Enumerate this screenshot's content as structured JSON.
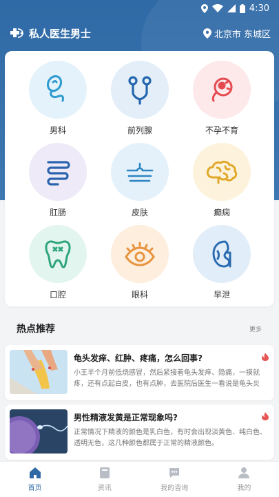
{
  "status": {
    "time": "4:30"
  },
  "header": {
    "title": "私人医生男士",
    "location": "北京市 东城区"
  },
  "categories": [
    {
      "label": "男科",
      "icon": "sperm-icon",
      "bg": "#e3f2fb"
    },
    {
      "label": "前列腺",
      "icon": "prostate-icon",
      "bg": "#e3eef9"
    },
    {
      "label": "不孕不育",
      "icon": "infertility-icon",
      "bg": "#fde8ea"
    },
    {
      "label": "肛肠",
      "icon": "intestine-icon",
      "bg": "#eeeaf7"
    },
    {
      "label": "皮肤",
      "icon": "skin-icon",
      "bg": "#e4f1fb"
    },
    {
      "label": "癫痫",
      "icon": "brain-icon",
      "bg": "#fdf3dc"
    },
    {
      "label": "口腔",
      "icon": "tooth-icon",
      "bg": "#e2f5ee"
    },
    {
      "label": "眼科",
      "icon": "eye-icon",
      "bg": "#fdeede"
    },
    {
      "label": "早泄",
      "icon": "kidney-icon",
      "bg": "#e1eef9"
    }
  ],
  "hot": {
    "title": "热点推荐",
    "more": "更多",
    "items": [
      {
        "title": "龟头发痒、红肿、疼痛，怎么回事?",
        "desc": "小王半个月前低烧感冒，然后紧接着龟头发痒、隐痛，一摸就疼，还有点起白皮，也有点肿，去医院后医生一看说是龟头炎"
      },
      {
        "title": "男性精液发黄是正常现象吗?",
        "desc": "正常情况下精液的颜色是乳白色，有时会出现淡黄色、纯白色、透明无色，这几种颜色都属于正常的精液颜色。"
      }
    ]
  },
  "tabs": [
    {
      "label": "首页",
      "icon": "home-icon"
    },
    {
      "label": "资讯",
      "icon": "news-icon"
    },
    {
      "label": "我的咨询",
      "icon": "chat-icon"
    },
    {
      "label": "我的",
      "icon": "user-icon"
    }
  ],
  "colors": {
    "primary": "#2f6aa6",
    "icon_blue": "#2e7fc2",
    "icon_red": "#e85454",
    "icon_yellow": "#e0a82a",
    "icon_orange": "#ea9a4a"
  }
}
